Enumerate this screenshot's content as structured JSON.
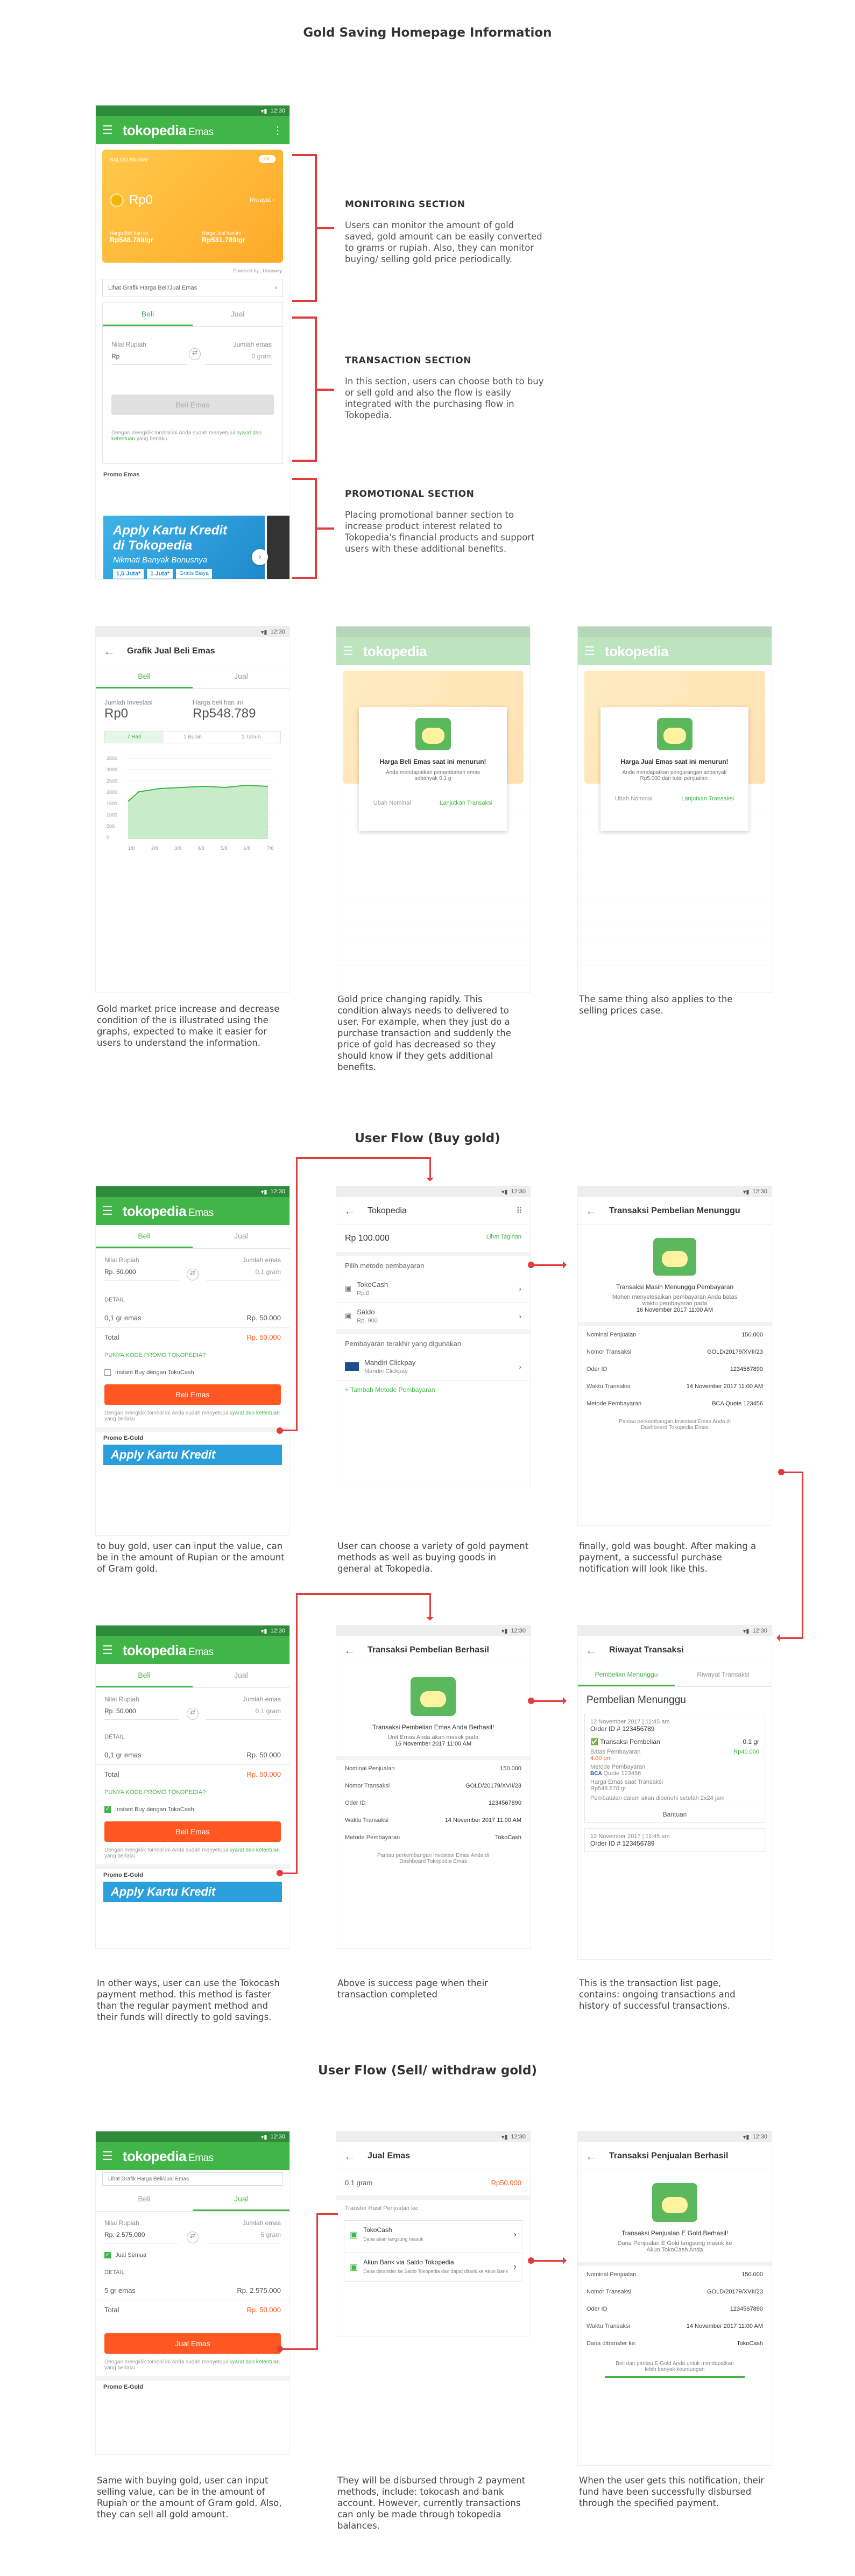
{
  "section1": {
    "title": "Gold Saving Homepage Information",
    "phone": {
      "time": "12:30",
      "brand": "tokopedia",
      "brand_sub": "Emas",
      "card": {
        "label": "SALDO ANTAM",
        "toggle": "Gr",
        "amount": "Rp0",
        "action": "Riwayat",
        "buy_label": "Harga Beli hari ini",
        "buy_value": "Rp548.789/gr",
        "sell_label": "Harga Jual hari ini",
        "sell_value": "Rp531.789/gr",
        "powered": "Powered by :",
        "powered_brand": "treasury"
      },
      "graph_link": "Lihat Grafik Harga Beli/Jual Emas",
      "tabs": [
        "Beli",
        "Jual"
      ],
      "nilai_rupiah": "Nilai Rupiah",
      "rp_prefix": "Rp",
      "jumlah_emas": "Jumlah emas",
      "zero_gram": "0 gram",
      "beli_button": "Beli Emas",
      "agreement": "Dengan mengklik tombol ini Anda sudah menyetujui",
      "agreement_link": "syarat dan ketentuan",
      "agreement_tail": "yang berlaku.",
      "promo_label": "Promo Emas",
      "promo_title_1": "Apply Kartu Kredit",
      "promo_title_2": "di Tokopedia",
      "promo_sub": "Nikmati Banyak Bonusnya",
      "promo_chip_1": "1,5 Juta*",
      "promo_chip_2": "1 Juta*",
      "promo_chip_3": "Gratis Biaya"
    },
    "annotations": [
      {
        "title": "MONITORING SECTION",
        "body": "Users can monitor the amount of gold saved, gold amount can be easily converted to grams or rupiah. Also, they can monitor buying/ selling gold price periodically."
      },
      {
        "title": "TRANSACTION SECTION",
        "body": "In this section, users can choose both to buy or sell gold and also the flow is easily integrated with the purchasing flow in Tokopedia."
      },
      {
        "title": "PROMOTIONAL SECTION",
        "body": "Placing promotional banner section to increase product interest related to Tokopedia's financial products and support users with these additional benefits."
      }
    ]
  },
  "section2": {
    "graph_phone": {
      "title": "Grafik Jual Beli Emas",
      "tabs": [
        "Beli",
        "Jual"
      ],
      "jumlah_label": "Jumlah Investasi",
      "jumlah_value": "Rp0",
      "harga_label": "Harga beli hari ini",
      "harga_value": "Rp548.789",
      "ranges": [
        "7 Hari",
        "1 Bulan",
        "1 Tahun"
      ],
      "y_ticks": [
        "3500",
        "3000",
        "2500",
        "2000",
        "1500",
        "1000",
        "500",
        "0"
      ],
      "x_ticks": [
        "1/8",
        "2/8",
        "3/8",
        "4/8",
        "5/8",
        "6/8",
        "7/8"
      ]
    },
    "modal_buy": {
      "title": "Harga Beli Emas saat ini menurun!",
      "body": "Anda mendapatkan penambahan emas sebanyak 0.1 g",
      "cancel": "Ubah Nominal",
      "confirm": "Lanjutkan Transaksi"
    },
    "modal_sell": {
      "title": "Harga Jual Emas saat ini menurun!",
      "body": "Anda mendapatkan pengurangan sebanyak Rp5.000 dari total penjualan.",
      "cancel": "Ubah Nominal",
      "confirm": "Lanjutkan Transaksi"
    },
    "captions": [
      "Gold market price increase and decrease condition of the is illustrated using the graphs, expected to make it easier for users to understand the information.",
      "Gold price changing rapidly. This condition always needs to delivered to user. For example, when they just do a purchase transaction and suddenly the price of gold has decreased so they should know if they gets additional benefits.",
      "The same thing also applies to the selling prices case."
    ]
  },
  "section3": {
    "title": "User Flow (Buy gold)",
    "buy_phone": {
      "tabs": [
        "Beli",
        "Jual"
      ],
      "nilai_rupiah": "Nilai Rupiah",
      "rp_value": "Rp. 50.000",
      "jumlah_emas": "Jumlah emas",
      "gram_value": "0,1 gram",
      "detail": "DETAIL",
      "item": "0,1 gr emas",
      "item_price": "Rp. 50.000",
      "total_label": "Total",
      "total_value": "Rp. 50.000",
      "promo_code": "PUNYA KODE PROMO TOKOPEDIA?",
      "instant": "Instant Buy dengan TokoCash",
      "beli_button": "Beli Emas",
      "promo_label": "Promo E-Gold",
      "banner": "Apply Kartu Kredit"
    },
    "payment_phone": {
      "title": "Tokopedia",
      "amount": "Rp 100.000",
      "detail_link": "Lihat Tagihan",
      "choose": "Pilih metode pembayaran",
      "methods": [
        {
          "name": "TokoCash",
          "sub": "Rp.0"
        },
        {
          "name": "Saldo",
          "sub": "Rp. 900"
        }
      ],
      "recent_label": "Pembayaran terakhir yang digunakan",
      "recent": {
        "name": "Mandiri Clickpay",
        "sub": "Mandiri Clickpay"
      },
      "add": "+ Tambah Metode Pembayaran"
    },
    "waiting_phone": {
      "title": "Transaksi Pembelian Menunggu",
      "status": "Transaksi Masih Menunggu Pembayaran",
      "note": "Mohon menyelesaikan pembayaran Anda batas waktu pembayaran pada",
      "deadline": "16 November 2017 11:00 AM",
      "rows": [
        {
          "k": "Nominal Penjualan",
          "v": "150.000"
        },
        {
          "k": "Nomor Transaksi",
          "v": "GOLD/20179/XVII/23"
        },
        {
          "k": "Oder ID",
          "v": "1234567890"
        },
        {
          "k": "Waktu Transaksi",
          "v": "14 November 2017 11:00 AM"
        },
        {
          "k": "Metode Pembayaran",
          "v": "BCA Quote 123456"
        }
      ],
      "footer": "Pantau perkembangan Investasi Emas Anda di Dashboard Tokopedia Emas"
    },
    "captions": [
      "to buy gold, user can input the value, can be in the amount of Rupian or the amount of Gram gold.",
      "User can choose a variety of gold payment methods as well as buying goods in general at Tokopedia.",
      "finally, gold was bought. After making a payment, a successful purchase notification will look like this."
    ]
  },
  "section4": {
    "success_phone": {
      "title": "Transaksi Pembelian Berhasil",
      "status": "Transaksi Pembelian Emas Anda Berhasil!",
      "note": "Unit Emas Anda akan masuk pada",
      "date": "16 November 2017 11:00 AM",
      "rows": [
        {
          "k": "Nominal Penjualan",
          "v": "150.000"
        },
        {
          "k": "Nomor Transaksi",
          "v": "GOLD/20179/XVII/23"
        },
        {
          "k": "Oder ID",
          "v": "1234567890"
        },
        {
          "k": "Waktu Transaksi",
          "v": "14 November 2017 11:00 AM"
        },
        {
          "k": "Metode Pembayaran",
          "v": "TokoCash"
        }
      ],
      "footer": "Pantau perkembangan Investasi Emas Anda di Dashboard Tokopedia Emas"
    },
    "history_phone": {
      "title": "Riwayat Transaksi",
      "tabs": [
        "Pembelian Menunggu",
        "Riwayat Transaksi"
      ],
      "heading": "Pembelian Menunggu",
      "entry_date": "12 November 2017 | 11:45 am",
      "order": "Order ID # 123456789",
      "type": "Transaksi Pembelian",
      "qty": "0.1 gr",
      "batas_label": "Batas Pembayaran",
      "batas_value": "4.00 pm",
      "price": "Rp40.000",
      "bank_label": "Metode Pembayaran",
      "bank": "BCA",
      "bank_code": "Quote 123456",
      "harga_label": "Harga Emas saat Transaksi",
      "harga_value": "Rp548.670 gr",
      "warning": "Pembatalan dalam akan dipenuhi setelah 2x24 jam",
      "help": "Bantuan",
      "entry2_date": "12 November 2017 | 11:45 am",
      "order2": "Order ID # 123456789"
    },
    "captions": [
      "In other ways, user can use the Tokocash payment method. this method is faster than the regular payment method and their funds will directly to gold savings.",
      "Above is success page when their transaction completed",
      "This is the transaction list page, contains: ongoing transactions and history of successful transactions."
    ]
  },
  "section5": {
    "title": "User Flow (Sell/ withdraw gold)",
    "sell_phone": {
      "graph_link": "Lihat Grafik Harga Beli/Jual Emas",
      "tabs": [
        "Beli",
        "Jual"
      ],
      "nilai_rupiah": "Nilai Rupiah",
      "rp_value": "Rp. 2.575.000",
      "jumlah_emas": "Jumlah emas",
      "gram_value": "5 gram",
      "jual_semua": "Jual Semua",
      "detail": "DETAIL",
      "item": "5 gr emas",
      "item_price": "Rp. 2.575.000",
      "total_label": "Total",
      "total_value": "Rp. 50.000",
      "button": "Jual Emas",
      "promo_label": "Promo E-Gold"
    },
    "disburse_phone": {
      "title": "Jual Emas",
      "gram": "0.1 gram",
      "price": "Rp50.000",
      "transfer_label": "Transfer Hasil Penjualan ke:",
      "options": [
        {
          "name": "TokoCash",
          "sub": "Dana akan langsung masuk"
        },
        {
          "name": "Akun Bank via Saldo Tokopedia",
          "sub": "Dana ditransfer ke Saldo Tokopedia dan dapat ditarik ke Akun Bank"
        }
      ]
    },
    "sold_phone": {
      "title": "Transaksi Penjualan Berhasil",
      "status": "Transaksi Penjualan E Gold Berhasil!",
      "note": "Dana Penjualan E Gold langsung masuk ke Akun TokoCash Anda",
      "rows": [
        {
          "k": "Nominal Penjualan",
          "v": "150.000"
        },
        {
          "k": "Nomor Transaksi",
          "v": "GOLD/20179/XVII/23"
        },
        {
          "k": "Oder ID",
          "v": "1234567890"
        },
        {
          "k": "Waktu Transaksi",
          "v": "14 November 2017 11:00 AM"
        },
        {
          "k": "Dana ditransfer ke:",
          "v": "TokoCash"
        }
      ],
      "footer": "Beli dan pantau E-Gold Anda untuk mendapatkan lebih banyak keuntungan"
    },
    "captions": [
      "Same with buying gold, user can input selling value, can be in the amount of Rupiah or the amount of Gram gold. Also, they can sell all gold amount.",
      "They will be disbursed through 2 payment methods, include: tokocash and bank account. However, currently transactions can only be made through tokopedia balances.",
      "When the user gets this notification, their fund have been successfully disbursed through the specified payment."
    ]
  },
  "colors": {
    "green": "#42b549",
    "orange": "#ff5722",
    "red_annotation": "#e23c3c",
    "gold": "#ffb833"
  }
}
